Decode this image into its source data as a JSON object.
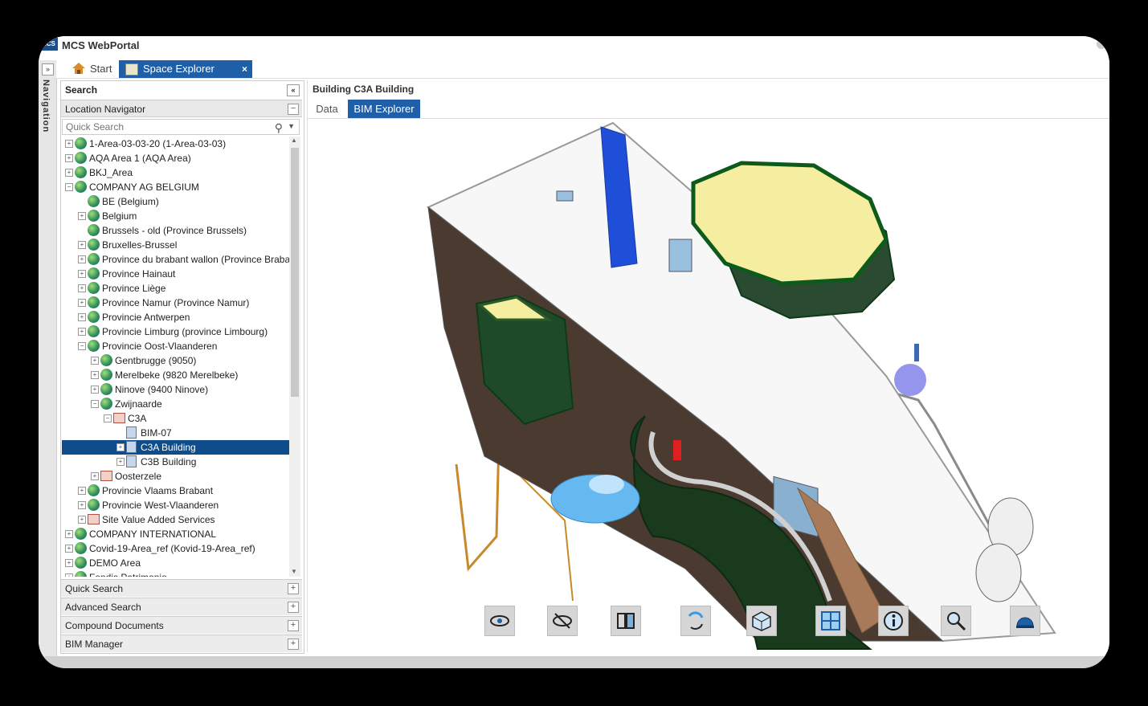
{
  "app": {
    "title": "MCS WebPortal",
    "logo_text": "MCS"
  },
  "navigation": {
    "label": "Navigation",
    "expand": "»"
  },
  "tabs": [
    {
      "label": "Start"
    },
    {
      "label": "Space Explorer",
      "close": "×"
    }
  ],
  "left": {
    "search_title": "Search",
    "collapse": "«",
    "location_navigator": "Location Navigator",
    "quick_search_placeholder": "Quick Search",
    "tree": [
      {
        "label": "1-Area-03-03-20 (1-Area-03-03)",
        "depth": 0,
        "exp": "+",
        "icon": "globe"
      },
      {
        "label": "AQA Area 1 (AQA Area)",
        "depth": 0,
        "exp": "+",
        "icon": "globe"
      },
      {
        "label": "BKJ_Area",
        "depth": 0,
        "exp": "+",
        "icon": "globe"
      },
      {
        "label": "COMPANY AG BELGIUM",
        "depth": 0,
        "exp": "−",
        "icon": "globe"
      },
      {
        "label": "BE (Belgium)",
        "depth": 1,
        "exp": "",
        "icon": "globe"
      },
      {
        "label": "Belgium",
        "depth": 1,
        "exp": "+",
        "icon": "globe"
      },
      {
        "label": "Brussels - old (Province Brussels)",
        "depth": 1,
        "exp": "",
        "icon": "globe"
      },
      {
        "label": "Bruxelles-Brussel",
        "depth": 1,
        "exp": "+",
        "icon": "globe"
      },
      {
        "label": "Province du brabant wallon (Province Brabant)",
        "depth": 1,
        "exp": "+",
        "icon": "globe"
      },
      {
        "label": "Province Hainaut",
        "depth": 1,
        "exp": "+",
        "icon": "globe"
      },
      {
        "label": "Province Liège",
        "depth": 1,
        "exp": "+",
        "icon": "globe"
      },
      {
        "label": "Province Namur (Province Namur)",
        "depth": 1,
        "exp": "+",
        "icon": "globe"
      },
      {
        "label": "Provincie Antwerpen",
        "depth": 1,
        "exp": "+",
        "icon": "globe"
      },
      {
        "label": "Provincie Limburg (province Limbourg)",
        "depth": 1,
        "exp": "+",
        "icon": "globe"
      },
      {
        "label": "Provincie Oost-Vlaanderen",
        "depth": 1,
        "exp": "−",
        "icon": "globe"
      },
      {
        "label": "Gentbrugge (9050)",
        "depth": 2,
        "exp": "+",
        "icon": "globe"
      },
      {
        "label": "Merelbeke (9820 Merelbeke)",
        "depth": 2,
        "exp": "+",
        "icon": "globe"
      },
      {
        "label": "Ninove (9400 Ninove)",
        "depth": 2,
        "exp": "+",
        "icon": "globe"
      },
      {
        "label": "Zwijnaarde",
        "depth": 2,
        "exp": "−",
        "icon": "globe"
      },
      {
        "label": "C3A",
        "depth": 3,
        "exp": "−",
        "icon": "building"
      },
      {
        "label": "BIM-07",
        "depth": 4,
        "exp": "",
        "icon": "doc"
      },
      {
        "label": "C3A Building",
        "depth": 4,
        "exp": "+",
        "icon": "doc",
        "selected": true
      },
      {
        "label": "C3B Building",
        "depth": 4,
        "exp": "+",
        "icon": "doc"
      },
      {
        "label": "Oosterzele",
        "depth": 2,
        "exp": "+",
        "icon": "building"
      },
      {
        "label": "Provincie Vlaams Brabant",
        "depth": 1,
        "exp": "+",
        "icon": "globe"
      },
      {
        "label": "Provincie West-Vlaanderen",
        "depth": 1,
        "exp": "+",
        "icon": "globe"
      },
      {
        "label": "Site Value Added Services",
        "depth": 1,
        "exp": "+",
        "icon": "building"
      },
      {
        "label": "COMPANY INTERNATIONAL",
        "depth": 0,
        "exp": "+",
        "icon": "globe"
      },
      {
        "label": "Covid-19-Area_ref (Kovid-19-Area_ref)",
        "depth": 0,
        "exp": "+",
        "icon": "globe"
      },
      {
        "label": "DEMO Area",
        "depth": 0,
        "exp": "+",
        "icon": "globe"
      },
      {
        "label": "Fondis Patrimonio",
        "depth": 0,
        "exp": "+",
        "icon": "globe"
      }
    ],
    "bottom_sections": [
      "Quick Search",
      "Advanced Search",
      "Compound Documents",
      "BIM Manager"
    ]
  },
  "right": {
    "title": "Building C3A Building",
    "subtabs": [
      "Data",
      "BIM Explorer"
    ]
  },
  "toolbar_icons": [
    "eye-icon",
    "eye-hidden-icon",
    "split-view-icon",
    "rotate-icon",
    "cube-view-icon",
    "puzzle-icon",
    "info-icon",
    "zoom-icon",
    "helmet-icon"
  ],
  "colors": {
    "accent": "#1f5fa8",
    "selected": "#0f4c8c"
  }
}
